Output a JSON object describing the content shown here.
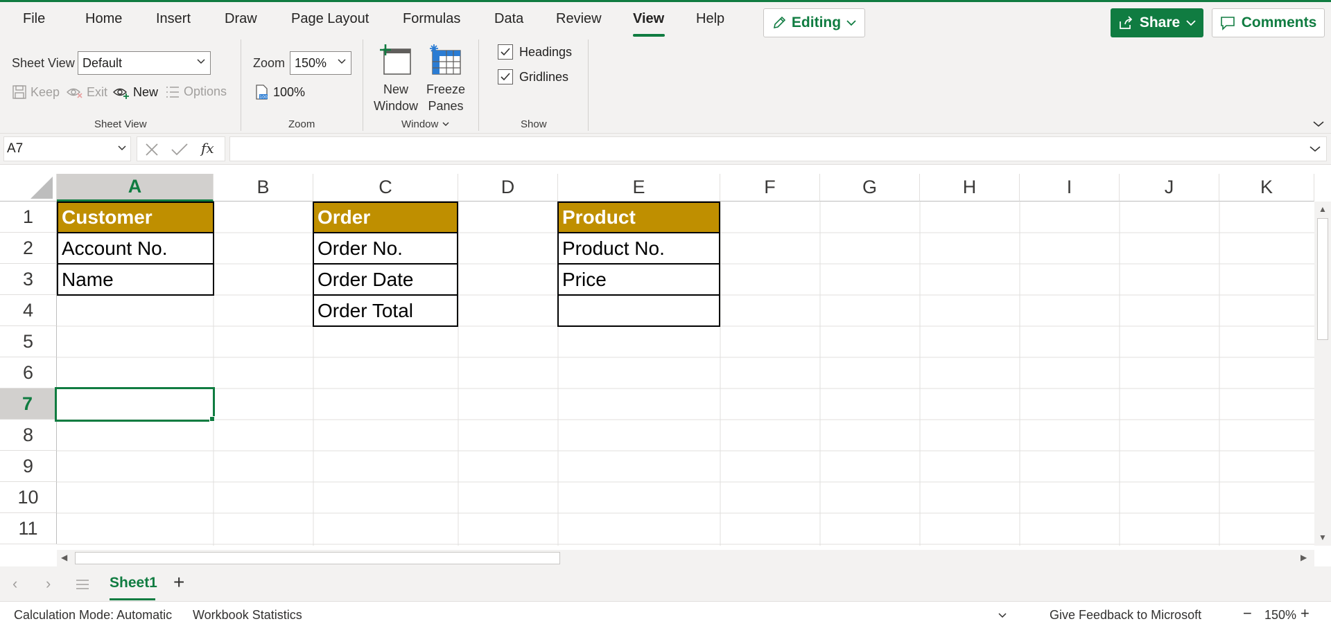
{
  "menu": {
    "items": [
      "File",
      "Home",
      "Insert",
      "Draw",
      "Page Layout",
      "Formulas",
      "Data",
      "Review",
      "View",
      "Help"
    ],
    "active": "View",
    "editing_label": "Editing",
    "share_label": "Share",
    "comments_label": "Comments"
  },
  "ribbon": {
    "sheet_view": {
      "label": "Sheet View",
      "dropdown_value": "Default",
      "keep": "Keep",
      "exit": "Exit",
      "new": "New",
      "options": "Options",
      "group_label": "Sheet View"
    },
    "zoom": {
      "label": "Zoom",
      "value": "150%",
      "hundred": "100%",
      "group_label": "Zoom"
    },
    "window": {
      "new_window_line1": "New",
      "new_window_line2": "Window",
      "freeze_line1": "Freeze",
      "freeze_line2": "Panes",
      "group_label": "Window"
    },
    "show": {
      "headings": "Headings",
      "gridlines": "Gridlines",
      "headings_checked": true,
      "gridlines_checked": true,
      "group_label": "Show"
    }
  },
  "formula_bar": {
    "name_box": "A7",
    "formula": "",
    "fx": "fx"
  },
  "grid": {
    "columns": [
      "A",
      "B",
      "C",
      "D",
      "E",
      "F",
      "G",
      "H",
      "I",
      "J",
      "K"
    ],
    "rows": [
      "1",
      "2",
      "3",
      "4",
      "5",
      "6",
      "7",
      "8",
      "9",
      "10",
      "11"
    ],
    "selected_column": "A",
    "selected_row": "7",
    "cells": {
      "A1": "Customer",
      "A2": "Account No.",
      "A3": "Name",
      "C1": "Order",
      "C2": "Order No.",
      "C3": "Order Date",
      "C4": "Order Total",
      "E1": "Product",
      "E2": "Product No.",
      "E3": "Price",
      "E4": ""
    },
    "header_fill": "#bf8f00"
  },
  "sheets": {
    "tabs": [
      "Sheet1"
    ],
    "active": "Sheet1"
  },
  "status": {
    "calc_mode": "Calculation Mode: Automatic",
    "workbook_stats": "Workbook Statistics",
    "feedback": "Give Feedback to Microsoft",
    "zoom": "150%"
  }
}
